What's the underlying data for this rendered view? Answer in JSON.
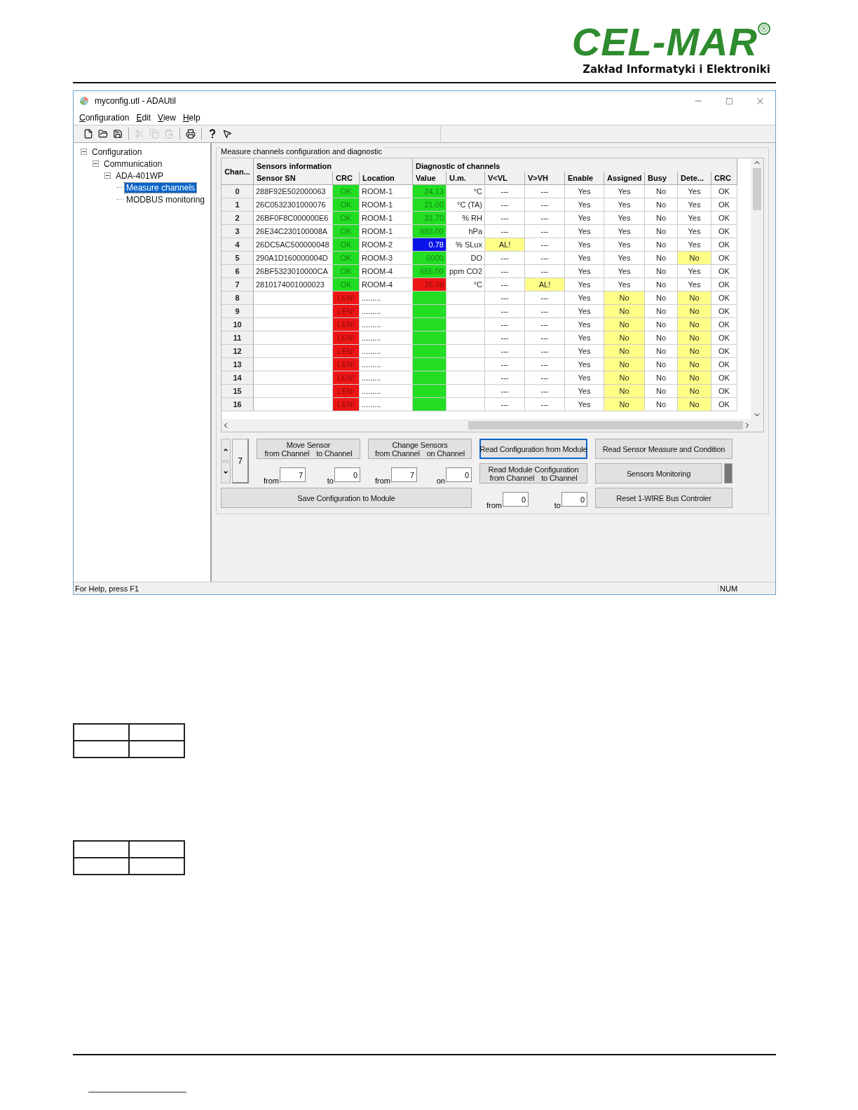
{
  "logo": {
    "brand": "CEL-MAR",
    "registered": "®",
    "subtitle": "Zakład Informatyki i Elektroniki"
  },
  "window": {
    "title": "myconfig.utl - ADAUtil"
  },
  "menu": [
    {
      "label": "Configuration"
    },
    {
      "label": "Edit"
    },
    {
      "label": "View"
    },
    {
      "label": "Help"
    }
  ],
  "toolbar": [
    {
      "kind": "new",
      "disabled": false
    },
    {
      "kind": "open",
      "disabled": false
    },
    {
      "kind": "save",
      "disabled": false
    },
    {
      "kind": "sep"
    },
    {
      "kind": "cut",
      "disabled": true
    },
    {
      "kind": "copy",
      "disabled": true
    },
    {
      "kind": "paste",
      "disabled": true
    },
    {
      "kind": "sep"
    },
    {
      "kind": "print",
      "disabled": false
    },
    {
      "kind": "sep"
    },
    {
      "kind": "help",
      "disabled": false
    },
    {
      "kind": "context_help",
      "disabled": false
    }
  ],
  "tree": [
    {
      "label": "Configuration",
      "expanded": true,
      "selected": false,
      "children": [
        {
          "label": "Communication",
          "expanded": true,
          "selected": false,
          "children": [
            {
              "label": "ADA-401WP",
              "expanded": true,
              "selected": false,
              "children": [
                {
                  "label": "Measure channels",
                  "selected": true
                },
                {
                  "label": "MODBUS monitoring",
                  "selected": false
                }
              ]
            }
          ]
        }
      ]
    }
  ],
  "panel": {
    "title": "Measure channels configuration and diagnostic"
  },
  "table": {
    "groups": [
      "Sensors information",
      "Diagnostic of channels"
    ],
    "columns": [
      "Chan...",
      "Sensor SN",
      "CRC",
      "Location",
      "Value",
      "U.m.",
      "V<VL",
      "V>VH",
      "Enable",
      "Assigned",
      "Busy",
      "Dete...",
      "CRC"
    ],
    "rows": [
      {
        "cells": [
          {
            "text": "0"
          },
          {
            "text": "288F92E502000063"
          },
          {
            "text": "OK",
            "color": "#22dd22"
          },
          {
            "text": "ROOM-1"
          },
          {
            "text": "24.13",
            "color": "#22dd22"
          },
          {
            "text": "°C"
          },
          {
            "text": "---"
          },
          {
            "text": "---"
          },
          {
            "text": "Yes"
          },
          {
            "text": "Yes"
          },
          {
            "text": "No"
          },
          {
            "text": "Yes"
          },
          {
            "text": "OK"
          }
        ]
      },
      {
        "cells": [
          {
            "text": "1"
          },
          {
            "text": "26C0532301000076"
          },
          {
            "text": "OK",
            "color": "#22dd22"
          },
          {
            "text": "ROOM-1"
          },
          {
            "text": "21.00",
            "color": "#22dd22"
          },
          {
            "text": "°C (TA)"
          },
          {
            "text": "---"
          },
          {
            "text": "---"
          },
          {
            "text": "Yes"
          },
          {
            "text": "Yes"
          },
          {
            "text": "No"
          },
          {
            "text": "Yes"
          },
          {
            "text": "OK"
          }
        ]
      },
      {
        "cells": [
          {
            "text": "2"
          },
          {
            "text": "26BF0F8C000000E6"
          },
          {
            "text": "OK",
            "color": "#22dd22"
          },
          {
            "text": "ROOM-1"
          },
          {
            "text": "31.70",
            "color": "#22dd22"
          },
          {
            "text": "% RH"
          },
          {
            "text": "---"
          },
          {
            "text": "---"
          },
          {
            "text": "Yes"
          },
          {
            "text": "Yes"
          },
          {
            "text": "No"
          },
          {
            "text": "Yes"
          },
          {
            "text": "OK"
          }
        ]
      },
      {
        "cells": [
          {
            "text": "3"
          },
          {
            "text": "26E34C230100008A"
          },
          {
            "text": "OK",
            "color": "#22dd22"
          },
          {
            "text": "ROOM-1"
          },
          {
            "text": "983.00",
            "color": "#22dd22"
          },
          {
            "text": "hPa"
          },
          {
            "text": "---"
          },
          {
            "text": "---"
          },
          {
            "text": "Yes"
          },
          {
            "text": "Yes"
          },
          {
            "text": "No"
          },
          {
            "text": "Yes"
          },
          {
            "text": "OK"
          }
        ]
      },
      {
        "cells": [
          {
            "text": "4"
          },
          {
            "text": "26DC5AC500000048"
          },
          {
            "text": "OK",
            "color": "#22dd22"
          },
          {
            "text": "ROOM-2"
          },
          {
            "text": "0.78",
            "color": "#0a14e8"
          },
          {
            "text": "% SLux"
          },
          {
            "text": "AL!",
            "color": "#ffff88"
          },
          {
            "text": "---"
          },
          {
            "text": "Yes"
          },
          {
            "text": "Yes"
          },
          {
            "text": "No"
          },
          {
            "text": "Yes"
          },
          {
            "text": "OK"
          }
        ]
      },
      {
        "cells": [
          {
            "text": "5"
          },
          {
            "text": "290A1D160000004D"
          },
          {
            "text": "OK",
            "color": "#22dd22"
          },
          {
            "text": "ROOM-3"
          },
          {
            "text": "0000",
            "color": "#22dd22"
          },
          {
            "text": "DO"
          },
          {
            "text": "---"
          },
          {
            "text": "---"
          },
          {
            "text": "Yes"
          },
          {
            "text": "Yes"
          },
          {
            "text": "No"
          },
          {
            "text": "No",
            "color": "#ffff88"
          },
          {
            "text": "OK"
          }
        ]
      },
      {
        "cells": [
          {
            "text": "6"
          },
          {
            "text": "26BF5323010000CA"
          },
          {
            "text": "OK",
            "color": "#22dd22"
          },
          {
            "text": "ROOM-4"
          },
          {
            "text": "655.00",
            "color": "#22dd22"
          },
          {
            "text": "ppm CO2"
          },
          {
            "text": "---"
          },
          {
            "text": "---"
          },
          {
            "text": "Yes"
          },
          {
            "text": "Yes"
          },
          {
            "text": "No"
          },
          {
            "text": "Yes"
          },
          {
            "text": "OK"
          }
        ]
      },
      {
        "cells": [
          {
            "text": "7"
          },
          {
            "text": "2810174001000023"
          },
          {
            "text": "OK",
            "color": "#22dd22"
          },
          {
            "text": "ROOM-4"
          },
          {
            "text": "26.38",
            "color": "#ee1515"
          },
          {
            "text": "°C"
          },
          {
            "text": "---"
          },
          {
            "text": "AL!",
            "color": "#ffff88"
          },
          {
            "text": "Yes"
          },
          {
            "text": "Yes"
          },
          {
            "text": "No"
          },
          {
            "text": "Yes"
          },
          {
            "text": "OK"
          }
        ]
      },
      {
        "cells": [
          {
            "text": "8"
          },
          {},
          {
            "text": "LEN!",
            "color": "#ee1515"
          },
          {
            "text": "........."
          },
          {
            "color": "#22dd22"
          },
          {},
          {
            "text": "---"
          },
          {
            "text": "---"
          },
          {
            "text": "Yes"
          },
          {
            "text": "No",
            "color": "#ffff88"
          },
          {
            "text": "No"
          },
          {
            "text": "No",
            "color": "#ffff88"
          },
          {
            "text": "OK"
          }
        ]
      },
      {
        "cells": [
          {
            "text": "9"
          },
          {},
          {
            "text": "LEN!",
            "color": "#ee1515"
          },
          {
            "text": "........."
          },
          {
            "color": "#22dd22"
          },
          {},
          {
            "text": "---"
          },
          {
            "text": "---"
          },
          {
            "text": "Yes"
          },
          {
            "text": "No",
            "color": "#ffff88"
          },
          {
            "text": "No"
          },
          {
            "text": "No",
            "color": "#ffff88"
          },
          {
            "text": "OK"
          }
        ]
      },
      {
        "cells": [
          {
            "text": "10"
          },
          {},
          {
            "text": "LEN!",
            "color": "#ee1515"
          },
          {
            "text": "........."
          },
          {
            "color": "#22dd22"
          },
          {},
          {
            "text": "---"
          },
          {
            "text": "---"
          },
          {
            "text": "Yes"
          },
          {
            "text": "No",
            "color": "#ffff88"
          },
          {
            "text": "No"
          },
          {
            "text": "No",
            "color": "#ffff88"
          },
          {
            "text": "OK"
          }
        ]
      },
      {
        "cells": [
          {
            "text": "11"
          },
          {},
          {
            "text": "LEN!",
            "color": "#ee1515"
          },
          {
            "text": "........."
          },
          {
            "color": "#22dd22"
          },
          {},
          {
            "text": "---"
          },
          {
            "text": "---"
          },
          {
            "text": "Yes"
          },
          {
            "text": "No",
            "color": "#ffff88"
          },
          {
            "text": "No"
          },
          {
            "text": "No",
            "color": "#ffff88"
          },
          {
            "text": "OK"
          }
        ]
      },
      {
        "cells": [
          {
            "text": "12"
          },
          {},
          {
            "text": "LEN!",
            "color": "#ee1515"
          },
          {
            "text": "........."
          },
          {
            "color": "#22dd22"
          },
          {},
          {
            "text": "---"
          },
          {
            "text": "---"
          },
          {
            "text": "Yes"
          },
          {
            "text": "No",
            "color": "#ffff88"
          },
          {
            "text": "No"
          },
          {
            "text": "No",
            "color": "#ffff88"
          },
          {
            "text": "OK"
          }
        ]
      },
      {
        "cells": [
          {
            "text": "13"
          },
          {},
          {
            "text": "LEN!",
            "color": "#ee1515"
          },
          {
            "text": "........."
          },
          {
            "color": "#22dd22"
          },
          {},
          {
            "text": "---"
          },
          {
            "text": "---"
          },
          {
            "text": "Yes"
          },
          {
            "text": "No",
            "color": "#ffff88"
          },
          {
            "text": "No"
          },
          {
            "text": "No",
            "color": "#ffff88"
          },
          {
            "text": "OK"
          }
        ]
      },
      {
        "cells": [
          {
            "text": "14"
          },
          {},
          {
            "text": "LEN!",
            "color": "#ee1515"
          },
          {
            "text": "........."
          },
          {
            "color": "#22dd22"
          },
          {},
          {
            "text": "---"
          },
          {
            "text": "---"
          },
          {
            "text": "Yes"
          },
          {
            "text": "No",
            "color": "#ffff88"
          },
          {
            "text": "No"
          },
          {
            "text": "No",
            "color": "#ffff88"
          },
          {
            "text": "OK"
          }
        ]
      },
      {
        "cells": [
          {
            "text": "15"
          },
          {},
          {
            "text": "LEN!",
            "color": "#ee1515"
          },
          {
            "text": "........."
          },
          {
            "color": "#22dd22"
          },
          {},
          {
            "text": "---"
          },
          {
            "text": "---"
          },
          {
            "text": "Yes"
          },
          {
            "text": "No",
            "color": "#ffff88"
          },
          {
            "text": "No"
          },
          {
            "text": "No",
            "color": "#ffff88"
          },
          {
            "text": "OK"
          }
        ]
      },
      {
        "cells": [
          {
            "text": "16"
          },
          {},
          {
            "text": "LEN!",
            "color": "#ee1515"
          },
          {
            "text": "........."
          },
          {
            "color": "#22dd22"
          },
          {},
          {
            "text": "---"
          },
          {
            "text": "---"
          },
          {
            "text": "Yes"
          },
          {
            "text": "No",
            "color": "#ffff88"
          },
          {
            "text": "No"
          },
          {
            "text": "No",
            "color": "#ffff88"
          },
          {
            "text": "OK"
          }
        ]
      }
    ]
  },
  "spinner": {
    "value": "7"
  },
  "move": {
    "title": "Move Sensor",
    "left": "from Channel",
    "right": "to Channel",
    "fields": [
      {
        "label": "from",
        "value": "7"
      },
      {
        "label": "to",
        "value": "0"
      }
    ]
  },
  "change": {
    "title": "Change Sensors",
    "left": "from Channel",
    "right": "on Channel",
    "fields": [
      {
        "label": "from",
        "value": "7"
      },
      {
        "label": "on",
        "value": "0"
      }
    ]
  },
  "read_module": {
    "title": "Read Module Configuration",
    "left": "from Channel",
    "right": "to Channel",
    "fields": [
      {
        "label": "from",
        "value": "0"
      },
      {
        "label": "to",
        "value": "0"
      }
    ]
  },
  "buttons": [
    {
      "label": "Read Configuration from Module",
      "focused": true
    },
    {
      "label": "Read Sensor Measure and  Condition",
      "focused": false
    },
    {
      "label": "Sensors Monitoring",
      "focused": false
    },
    {
      "label": "Save Configuration to Module",
      "focused": false
    },
    {
      "label": "Reset 1-WIRE Bus Controler",
      "focused": false
    }
  ],
  "status_bar": {
    "help": "For Help, press F1",
    "num": "NUM"
  }
}
